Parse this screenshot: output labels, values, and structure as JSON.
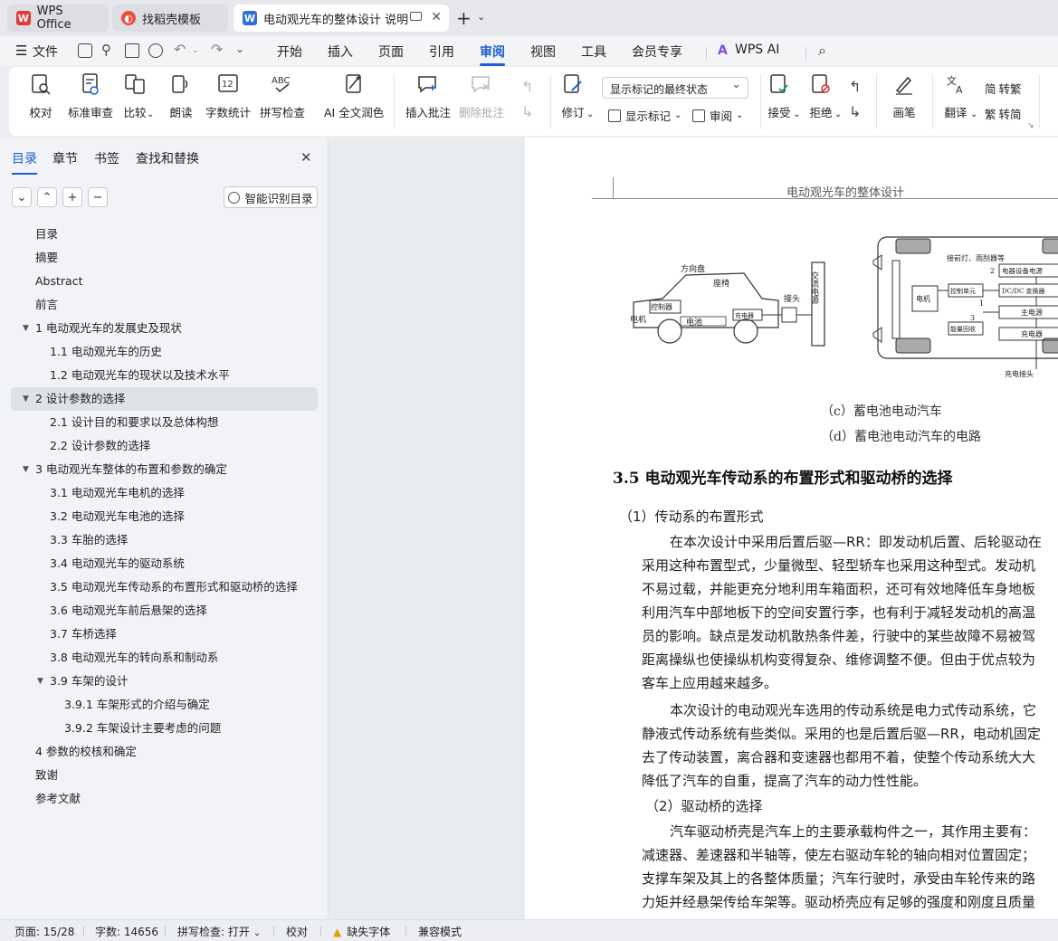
{
  "tabs": [
    {
      "label": "WPS Office"
    },
    {
      "label": "找稻壳模板"
    },
    {
      "label": "电动观光车的整体设计 说明书"
    }
  ],
  "menu": {
    "file": "文件",
    "items": [
      "开始",
      "插入",
      "页面",
      "引用",
      "审阅",
      "视图",
      "工具",
      "会员专享"
    ],
    "active": "审阅",
    "wps_ai": "WPS AI"
  },
  "ribbon": {
    "proofread": "校对",
    "std_review": "标准审查",
    "compare": "比较",
    "read_aloud": "朗读",
    "word_count": "字数统计",
    "spell_check": "拼写检查",
    "ai_polish": "AI 全文润色",
    "insert_comment": "插入批注",
    "delete_comment": "删除批注",
    "revise": "修订",
    "markup_select": "显示标记的最终状态",
    "show_markup": "显示标记",
    "review": "审阅",
    "accept": "接受",
    "reject": "拒绝",
    "pen": "画笔",
    "translate": "翻译",
    "to_traditional": "转繁",
    "to_simplified": "转简",
    "count_badge": "12"
  },
  "sidebar": {
    "tabs": [
      "目录",
      "章节",
      "书签",
      "查找和替换"
    ],
    "smart_button": "智能识别目录",
    "toc": [
      {
        "label": "目录",
        "level": 0,
        "arrow": false
      },
      {
        "label": "摘要",
        "level": 0,
        "arrow": false
      },
      {
        "label": "Abstract",
        "level": 0,
        "arrow": false
      },
      {
        "label": "前言",
        "level": 0,
        "arrow": false
      },
      {
        "label": "1 电动观光车的发展史及现状",
        "level": 0,
        "arrow": true
      },
      {
        "label": "1.1 电动观光车的历史",
        "level": 1,
        "arrow": false
      },
      {
        "label": "1.2 电动观光车的现状以及技术水平",
        "level": 1,
        "arrow": false
      },
      {
        "label": "2 设计参数的选择",
        "level": 0,
        "arrow": true,
        "selected": true
      },
      {
        "label": "2.1 设计目的和要求以及总体构想",
        "level": 1,
        "arrow": false
      },
      {
        "label": "2.2 设计参数的选择",
        "level": 1,
        "arrow": false
      },
      {
        "label": "3 电动观光车整体的布置和参数的确定",
        "level": 0,
        "arrow": true
      },
      {
        "label": "3.1 电动观光车电机的选择",
        "level": 1,
        "arrow": false
      },
      {
        "label": "3.2 电动观光车电池的选择",
        "level": 1,
        "arrow": false
      },
      {
        "label": "3.3 车胎的选择",
        "level": 1,
        "arrow": false
      },
      {
        "label": "3.4 电动观光车的驱动系统",
        "level": 1,
        "arrow": false
      },
      {
        "label": "3.5 电动观光车传动系的布置形式和驱动桥的选择",
        "level": 1,
        "arrow": false
      },
      {
        "label": "3.6 电动观光车前后悬架的选择",
        "level": 1,
        "arrow": false
      },
      {
        "label": "3.7 车桥选择",
        "level": 1,
        "arrow": false
      },
      {
        "label": "3.8 电动观光车的转向系和制动系",
        "level": 1,
        "arrow": false
      },
      {
        "label": "3.9 车架的设计",
        "level": 1,
        "arrow": true
      },
      {
        "label": "3.9.1 车架形式的介绍与确定",
        "level": 2,
        "arrow": false
      },
      {
        "label": "3.9.2 车架设计主要考虑的问题",
        "level": 2,
        "arrow": false
      },
      {
        "label": "4 参数的校核和确定",
        "level": 0,
        "arrow": false
      },
      {
        "label": "致谢",
        "level": 0,
        "arrow": false
      },
      {
        "label": "参考文献",
        "level": 0,
        "arrow": false
      }
    ]
  },
  "document": {
    "header": "电动观光车的整体设计",
    "figure_left": {
      "steering": "方向盘",
      "seat": "座椅",
      "controller": "控制器",
      "motor": "电机",
      "battery": "电池",
      "charger": "充电器",
      "plug": "接头",
      "ac_source": "交流电源"
    },
    "figure_right": {
      "lights": "接前灯、雨刮器等",
      "aux_power": "电器设备电源",
      "motor": "电机",
      "control_unit": "控制单元",
      "dcdc": "DC/DC 变换器",
      "main_power": "主电源",
      "energy_recovery": "能量回收",
      "charger": "充电器",
      "charge_plug": "充电接头",
      "n1": "1",
      "n2": "2",
      "n3": "3"
    },
    "caption_c": "（c）蓄电池电动汽车",
    "caption_d": "（d）蓄电池电动汽车的电路",
    "section_title": "3.5 电动观光车传动系的布置形式和驱动桥的选择",
    "lines": [
      "（1）传动系的布置形式",
      "在本次设计中采用后置后驱—RR：即发动机后置、后轮驱动在",
      "采用这种布置型式，少量微型、轻型轿车也采用这种型式。发动机",
      "不易过载，并能更充分地利用车箱面积，还可有效地降低车身地板",
      "利用汽车中部地板下的空间安置行李，也有利于减轻发动机的高温",
      "员的影响。缺点是发动机散热条件差，行驶中的某些故障不易被驾",
      "距离操纵也使操纵机构变得复杂、维修调整不便。但由于优点较为",
      "客车上应用越来越多。",
      "本次设计的电动观光车选用的传动系统是电力式传动系统，它",
      "静液式传动系统有些类似。采用的也是后置后驱—RR，电动机固定",
      "去了传动装置，离合器和变速器也都用不着，使整个传动系统大大",
      "降低了汽车的自重，提高了汽车的动力性性能。",
      "（2）驱动桥的选择",
      "汽车驱动桥壳是汽车上的主要承载构件之一，其作用主要有：",
      "减速器、差速器和半轴等，使左右驱动车轮的轴向相对位置固定；",
      "支撑车架及其上的各整体质量；汽车行驶时，承受由车轮传来的路",
      "力矩并经悬架传给车架等。驱动桥壳应有足够的强度和刚度且质量"
    ]
  },
  "status": {
    "page": "页面: 15/28",
    "words": "字数: 14656",
    "spell": "拼写检查: 打开",
    "proof": "校对",
    "missing_font": "缺失字体",
    "compat": "兼容模式"
  }
}
